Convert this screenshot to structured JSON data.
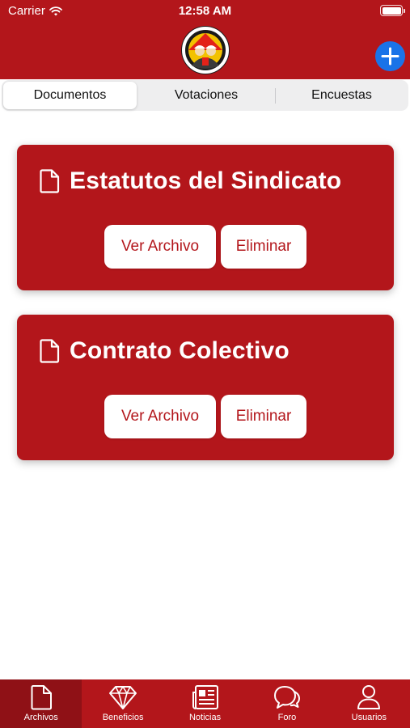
{
  "status_bar": {
    "carrier": "Carrier",
    "time": "12:58 AM"
  },
  "header": {
    "logo_icon": "union-logo-icon",
    "add_icon": "plus-icon"
  },
  "segments": [
    {
      "label": "Documentos",
      "active": true
    },
    {
      "label": "Votaciones",
      "active": false
    },
    {
      "label": "Encuestas",
      "active": false
    }
  ],
  "documents": [
    {
      "title": "Estatutos del Sindicato",
      "view_label": "Ver Archivo",
      "delete_label": "Eliminar"
    },
    {
      "title": "Contrato Colectivo",
      "view_label": "Ver Archivo",
      "delete_label": "Eliminar"
    }
  ],
  "tabbar": [
    {
      "label": "Archivos",
      "icon": "document-icon",
      "active": true
    },
    {
      "label": "Beneficios",
      "icon": "diamond-icon",
      "active": false
    },
    {
      "label": "Noticias",
      "icon": "newspaper-icon",
      "active": false
    },
    {
      "label": "Foro",
      "icon": "chat-bubbles-icon",
      "active": false
    },
    {
      "label": "Usuarios",
      "icon": "user-icon",
      "active": false
    }
  ],
  "colors": {
    "brand": "#b3161b",
    "brand_dark": "#8f1116",
    "accent_blue": "#1a73e8"
  }
}
